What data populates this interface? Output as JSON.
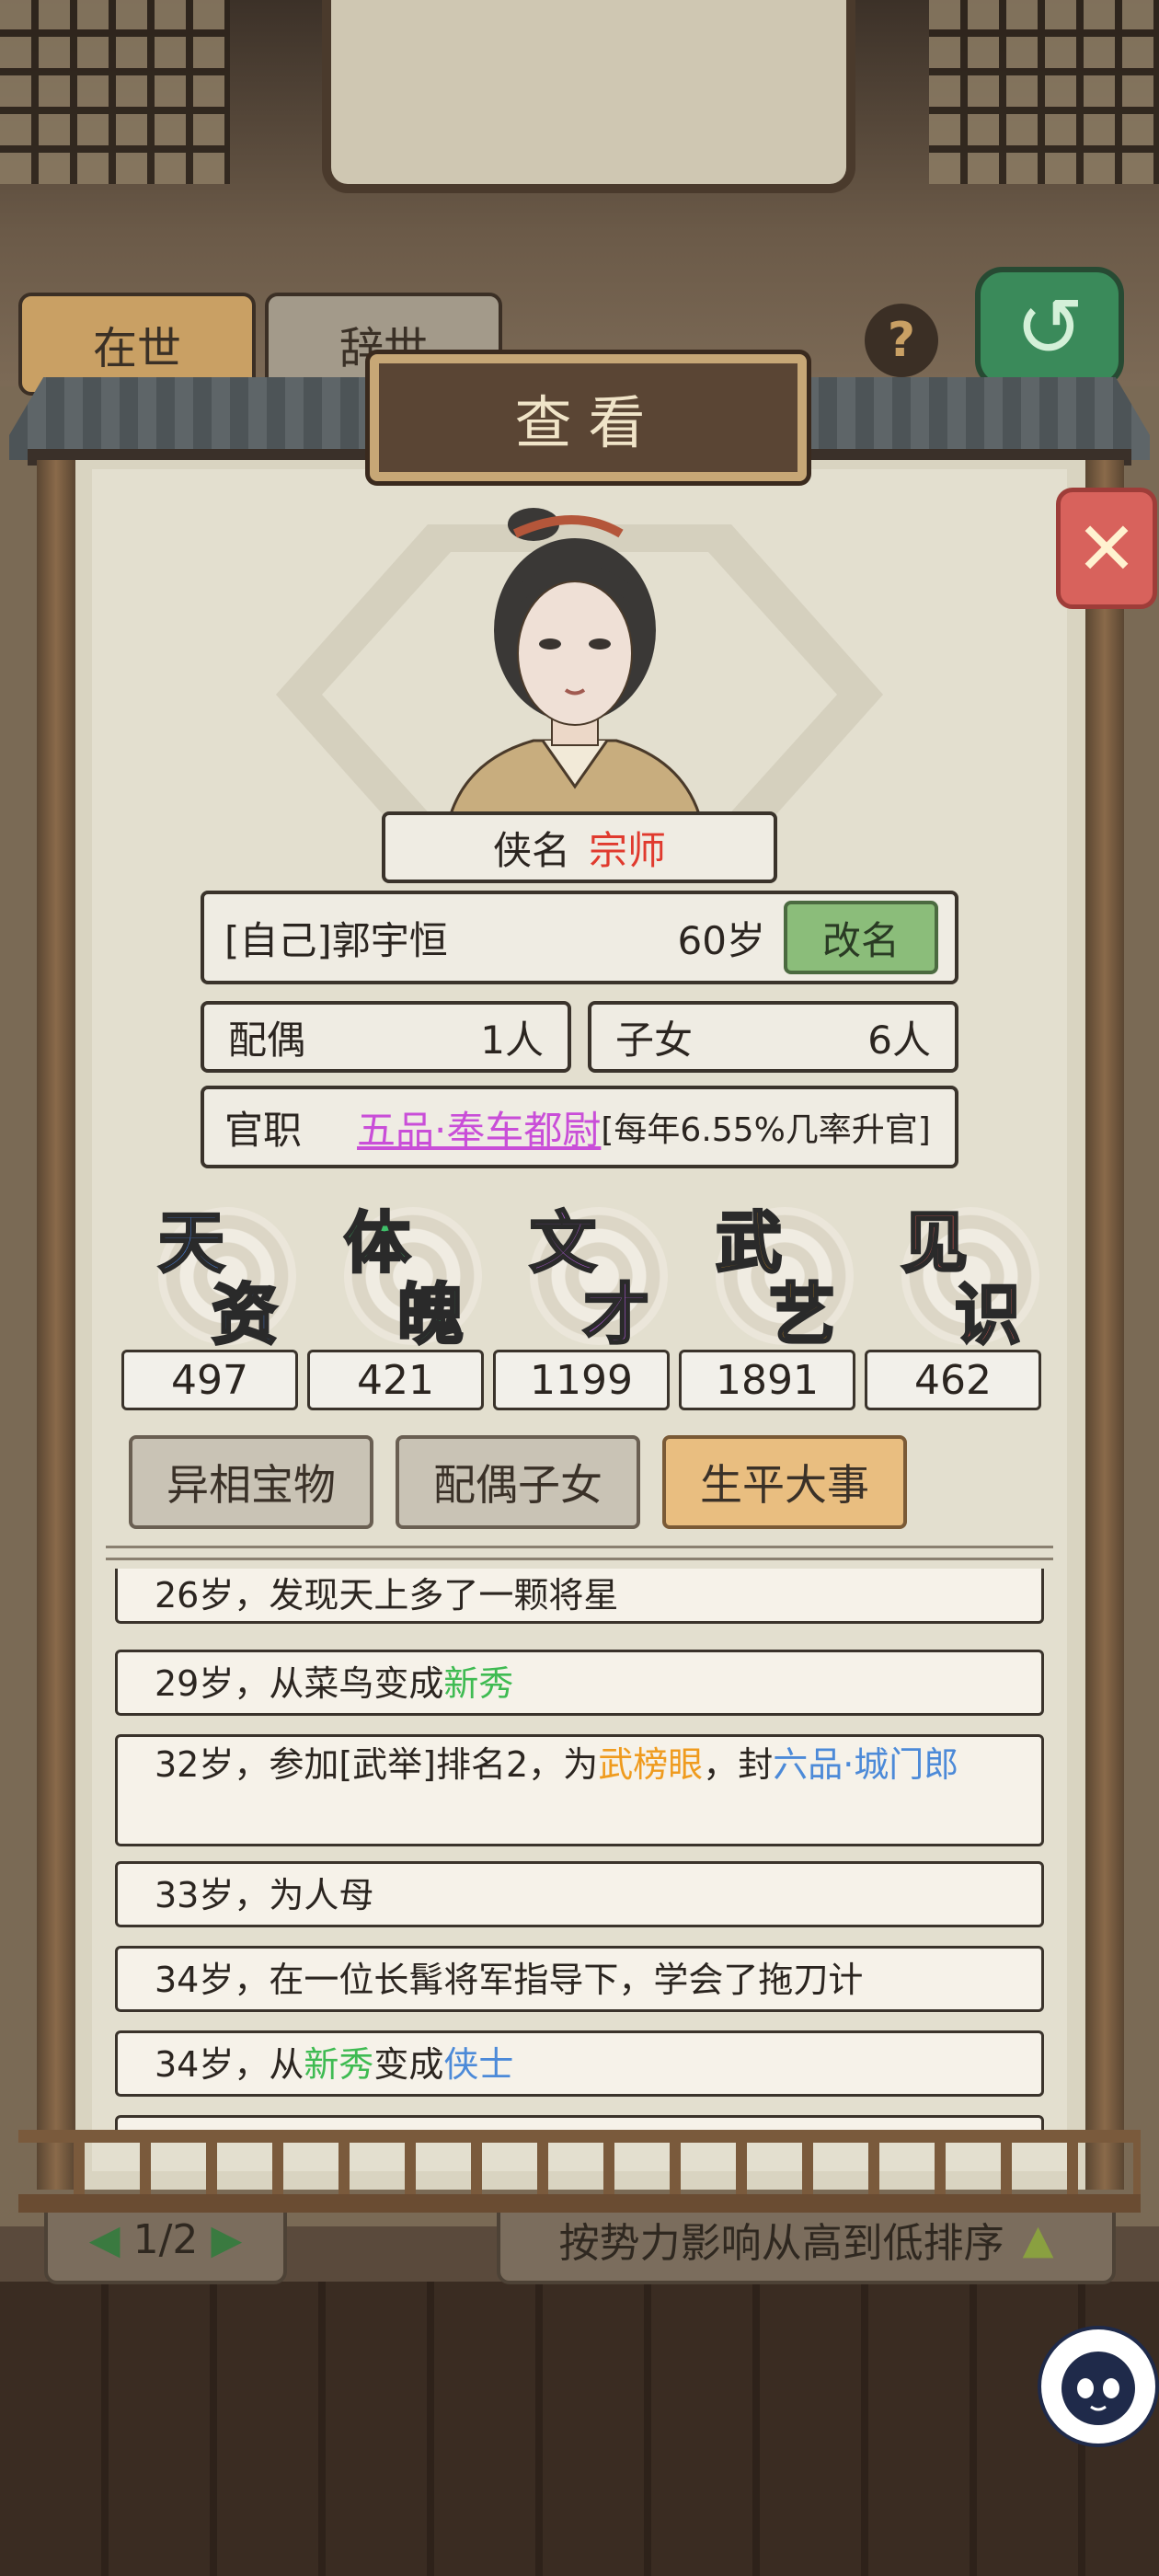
{
  "background": {
    "tabs": [
      "在世",
      "辞世"
    ],
    "help": "?",
    "pager": {
      "text": "1/2"
    },
    "sort_label": "按势力影响从高到低排序"
  },
  "panel": {
    "title": "查看",
    "hero_title_label": "侠名",
    "hero_title_value": "宗师",
    "name": "[自己]郭宇恒",
    "age": "60岁",
    "rename_button": "改名",
    "spouse_label": "配偶",
    "spouse_count": "1人",
    "children_label": "子女",
    "children_count": "6人",
    "office_label": "官职",
    "office_value": "五品·奉车都尉",
    "office_note": "[每年6.55%几率升官]"
  },
  "attributes": [
    {
      "c1": "天",
      "c2": "资",
      "color": "#4a86e8",
      "value": "497"
    },
    {
      "c1": "体",
      "c2": "魄",
      "color": "#3fbf6a",
      "value": "421"
    },
    {
      "c1": "文",
      "c2": "才",
      "color": "#b05ad8",
      "value": "1199"
    },
    {
      "c1": "武",
      "c2": "艺",
      "color": "#f0a01e",
      "value": "1891"
    },
    {
      "c1": "见",
      "c2": "识",
      "color": "#e8605a",
      "value": "462"
    }
  ],
  "tabs": [
    {
      "label": "异相宝物",
      "active": false
    },
    {
      "label": "配偶子女",
      "active": false
    },
    {
      "label": "生平大事",
      "active": true
    }
  ],
  "events": [
    {
      "parts": [
        "26岁，发现天上多了一颗将星"
      ]
    },
    {
      "parts": [
        "29岁，从菜鸟变成",
        "新秀"
      ]
    },
    {
      "parts": [
        "32岁，参加[武举]排名2，为",
        "武榜眼",
        "，封",
        "六品·城门郎"
      ]
    },
    {
      "parts": [
        "33岁，为人母"
      ]
    },
    {
      "parts": [
        "34岁，在一位长髯将军指导下，学会了拖刀计"
      ]
    },
    {
      "parts": [
        "34岁，从",
        "新秀",
        "变成",
        "侠士"
      ]
    }
  ],
  "colors": {
    "highlight_green": "#3fbb52",
    "highlight_orange": "#ef9b1e",
    "highlight_blue": "#4c8ad8",
    "title_red": "#e03a2e",
    "office_purple": "#c94ed8"
  }
}
